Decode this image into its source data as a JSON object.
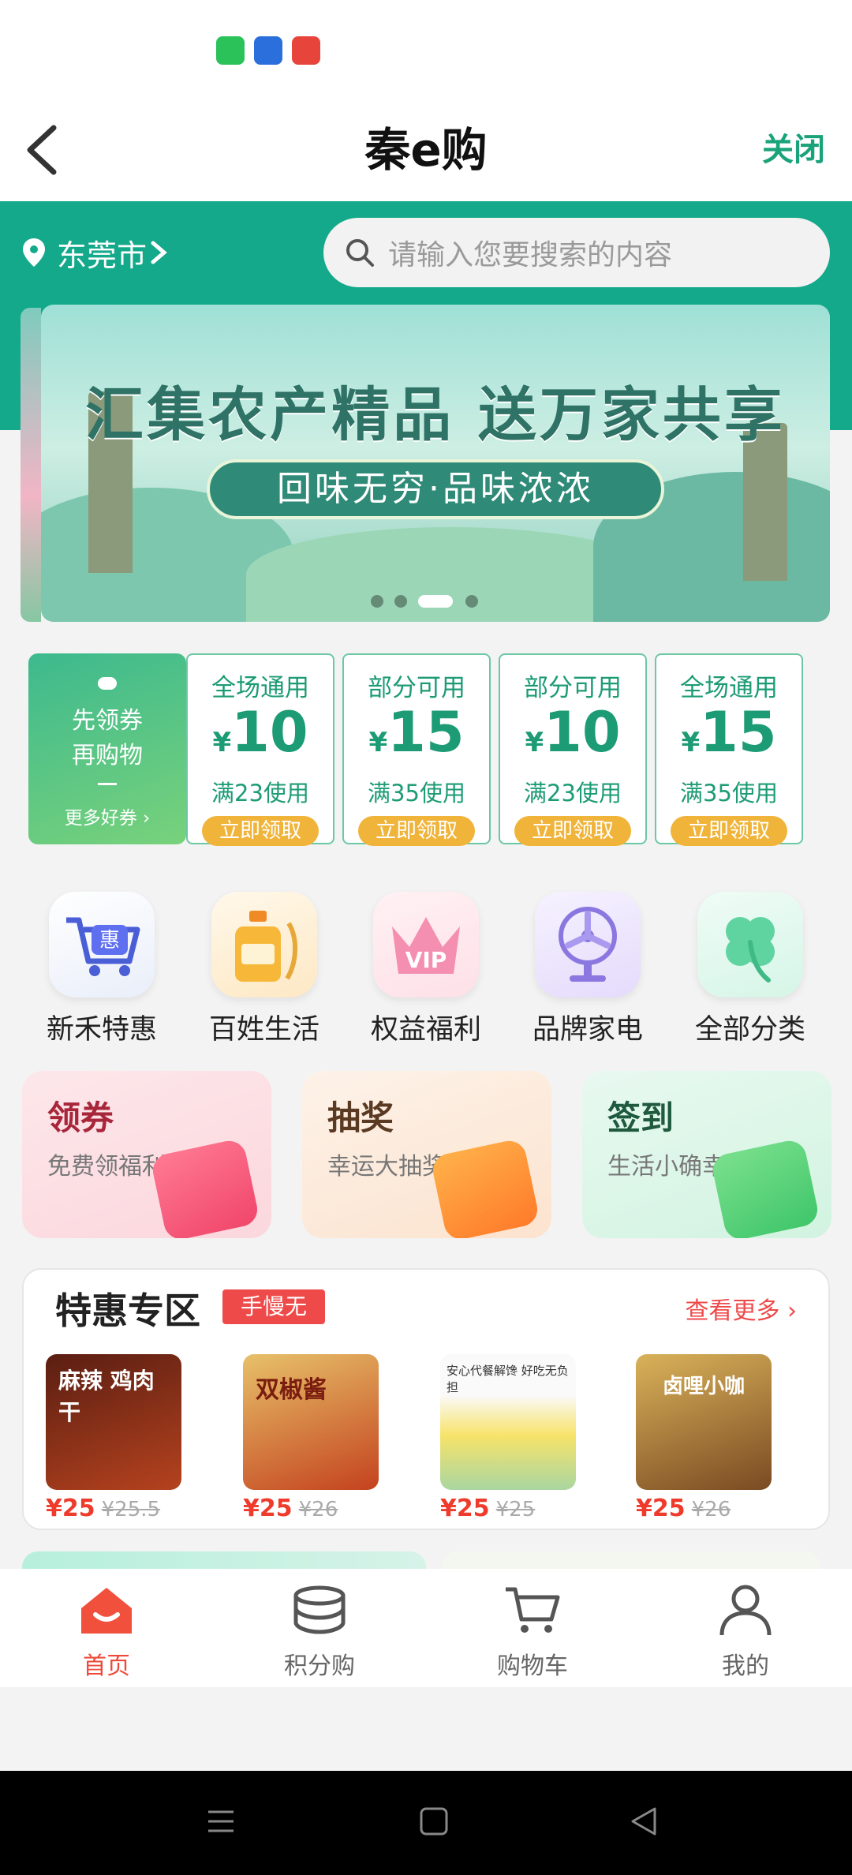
{
  "nav": {
    "title": "秦e购",
    "close_label": "关闭"
  },
  "header": {
    "location": "东莞市",
    "search_placeholder": "请输入您要搜索的内容"
  },
  "banner": {
    "title": "汇集农产精品 送万家共享",
    "subtitle": "回味无穷·品味浓浓"
  },
  "coupon_lead": {
    "line1": "先领券",
    "line2": "再购物",
    "more": "更多好券"
  },
  "coupons": [
    {
      "type": "全场通用",
      "currency": "¥",
      "amount": "10",
      "condition": "满23使用",
      "button": "立即领取"
    },
    {
      "type": "部分可用",
      "currency": "¥",
      "amount": "15",
      "condition": "满35使用",
      "button": "立即领取"
    },
    {
      "type": "部分可用",
      "currency": "¥",
      "amount": "10",
      "condition": "满23使用",
      "button": "立即领取"
    },
    {
      "type": "全场通用",
      "currency": "¥",
      "amount": "15",
      "condition": "满35使用",
      "button": "立即领取"
    }
  ],
  "categories": [
    {
      "label": "新禾特惠",
      "icon": "cart-discount-icon"
    },
    {
      "label": "百姓生活",
      "icon": "oil-bottle-icon"
    },
    {
      "label": "权益福利",
      "icon": "vip-crown-icon"
    },
    {
      "label": "品牌家电",
      "icon": "fan-icon"
    },
    {
      "label": "全部分类",
      "icon": "clover-icon"
    }
  ],
  "promos": [
    {
      "title": "领券",
      "subtitle": "免费领福利",
      "color": "#fde7ea"
    },
    {
      "title": "抽奖",
      "subtitle": "幸运大抽奖",
      "color": "#fdf0e6"
    },
    {
      "title": "签到",
      "subtitle": "生活小确幸",
      "color": "#e5f7ee"
    }
  ],
  "special": {
    "title": "特惠专区",
    "tag": "手慢无",
    "more": "查看更多",
    "products": [
      {
        "price": "¥25",
        "original": "¥25.5",
        "image_text": "麻辣 鸡肉干"
      },
      {
        "price": "¥25",
        "original": "¥26",
        "image_text": "双椒酱"
      },
      {
        "price": "¥25",
        "original": "¥25",
        "image_text": "安心代餐解馋 好吃无负担"
      },
      {
        "price": "¥25",
        "original": "¥26",
        "image_text": "卤哩小咖"
      }
    ]
  },
  "tabs": [
    {
      "label": "首页",
      "active": true
    },
    {
      "label": "积分购",
      "active": false
    },
    {
      "label": "购物车",
      "active": false
    },
    {
      "label": "我的",
      "active": false
    }
  ],
  "colors": {
    "brand_green": "#13a98a",
    "accent_red": "#ee4a4a",
    "coupon_button": "#f0b43a"
  }
}
